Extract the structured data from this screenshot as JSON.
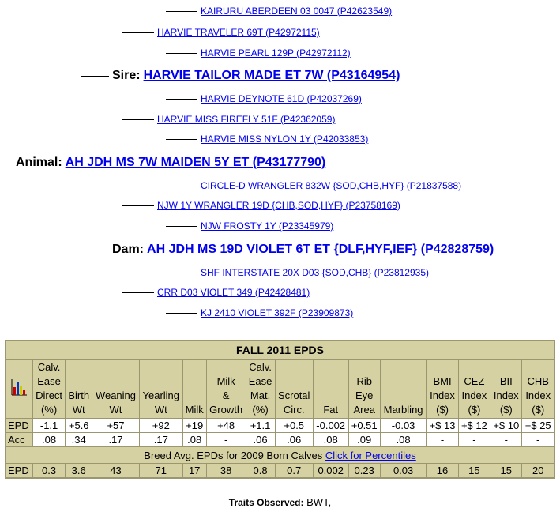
{
  "pedigree": {
    "sss": "KAIRURU ABERDEEN 03 0047 (P42623549)",
    "ss": "HARVIE TRAVELER 69T (P42972115)",
    "ssd": "HARVIE PEARL 129P (P42972112)",
    "sire_label": "Sire:",
    "sire": "HARVIE TAILOR MADE ET 7W (P43164954)",
    "sds": "HARVIE DEYNOTE 61D (P42037269)",
    "sd": "HARVIE MISS FIREFLY 51F (P42362059)",
    "sdd": "HARVIE MISS NYLON 1Y (P42033853)",
    "animal_label": "Animal:",
    "animal": "AH JDH MS 7W MAIDEN 5Y ET (P43177790)",
    "dss": "CIRCLE-D WRANGLER 832W {SOD,CHB,HYF} (P21837588)",
    "ds": "NJW 1Y WRANGLER 19D {CHB,SOD,HYF} (P23758169)",
    "dsd": "NJW FROSTY 1Y (P23345979)",
    "dam_label": "Dam:",
    "dam": "AH JDH MS 19D VIOLET 6T ET {DLF,HYF,IEF} (P42828759)",
    "dds": "SHF INTERSTATE 20X D03 {SOD,CHB} (P23812935)",
    "dd": "CRR D03 VIOLET 349 (P42428481)",
    "ddd": "KJ 2410 VIOLET 392F (P23909873)"
  },
  "epd_table": {
    "title": "FALL 2011 EPDS",
    "chart_icon": "bar-chart-icon",
    "headers": [
      [
        "Calv.",
        "Ease",
        "Direct",
        "(%)"
      ],
      [
        "Birth",
        "Wt"
      ],
      [
        "Weaning",
        "Wt"
      ],
      [
        "Yearling",
        "Wt"
      ],
      [
        "Milk"
      ],
      [
        "Milk",
        "&",
        "Growth"
      ],
      [
        "Calv.",
        "Ease",
        "Mat.",
        "(%)"
      ],
      [
        "Scrotal",
        "Circ."
      ],
      [
        "Fat"
      ],
      [
        "Rib",
        "Eye",
        "Area"
      ],
      [
        "Marbling"
      ],
      [
        "BMI",
        "Index",
        "($)"
      ],
      [
        "CEZ",
        "Index",
        "($)"
      ],
      [
        "BII",
        "Index",
        "($)"
      ],
      [
        "CHB",
        "Index",
        "($)"
      ]
    ],
    "epd_label": "EPD",
    "epd_values": [
      "-1.1",
      "+5.6",
      "+57",
      "+92",
      "+19",
      "+48",
      "+1.1",
      "+0.5",
      "-0.002",
      "+0.51",
      "-0.03",
      "+$ 13",
      "+$ 12",
      "+$ 10",
      "+$ 25"
    ],
    "acc_label": "Acc",
    "acc_values": [
      ".08",
      ".34",
      ".17",
      ".17",
      ".08",
      "-",
      ".06",
      ".06",
      ".08",
      ".09",
      ".08",
      "-",
      "-",
      "-",
      "-"
    ],
    "breed_text": "Breed Avg. EPDs for 2009 Born Calves ",
    "breed_link": "Click for Percentiles",
    "avg_label": "EPD",
    "avg_values": [
      "0.3",
      "3.6",
      "43",
      "71",
      "17",
      "38",
      "0.8",
      "0.7",
      "0.002",
      "0.23",
      "0.03",
      "16",
      "15",
      "15",
      "20"
    ]
  },
  "traits": {
    "label": "Traits Observed:",
    "value": " BWT,"
  }
}
